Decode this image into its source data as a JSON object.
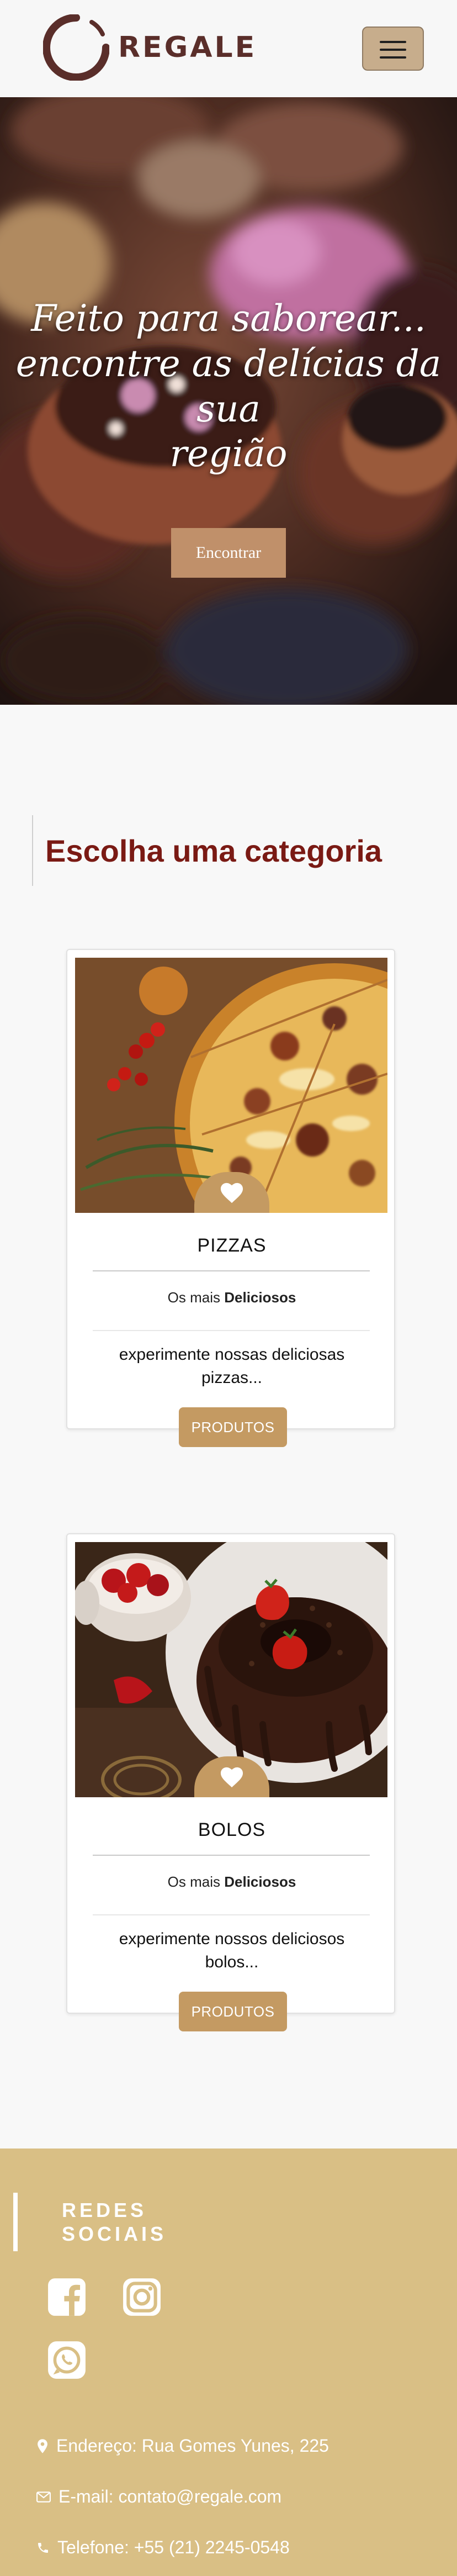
{
  "header": {
    "logo_text": "REGALE",
    "menu_icon": "hamburger-menu-icon"
  },
  "hero": {
    "title_line1": "Feito para saborear...",
    "title_line2": "encontre as delícias da sua",
    "title_line3": "região",
    "button_label": "Encontrar"
  },
  "categories": {
    "title_prefix": "Escolha uma ",
    "title_bold": "categoria",
    "items": [
      {
        "name": "PIZZAS",
        "sub_prefix": "Os mais ",
        "sub_bold": "Deliciosos",
        "description": "experimente nossas deliciosas pizzas...",
        "button_label": "PRODUTOS",
        "badge_icon": "heart-icon"
      },
      {
        "name": "BOLOS",
        "sub_prefix": "Os mais ",
        "sub_bold": "Deliciosos",
        "description": "experimente nossos deliciosos bolos...",
        "button_label": "PRODUTOS",
        "badge_icon": "heart-icon"
      }
    ]
  },
  "footer": {
    "social_title": "REDES SOCIAIS",
    "social_icons": [
      "facebook-icon",
      "instagram-icon",
      "whatsapp-icon"
    ],
    "address": "Endereço: Rua Gomes Yunes, 225",
    "email": "E-mail: contato@regale.com",
    "phone": "Telefone: +55 (21) 2245-0548"
  },
  "colors": {
    "brand_dark": "#5a2e2a",
    "category_title": "#7a1a14",
    "accent_button": "#c49a62",
    "hero_button": "#c0906a",
    "menu_button": "#c7ad8c",
    "footer_bg": "#d9bf85"
  }
}
